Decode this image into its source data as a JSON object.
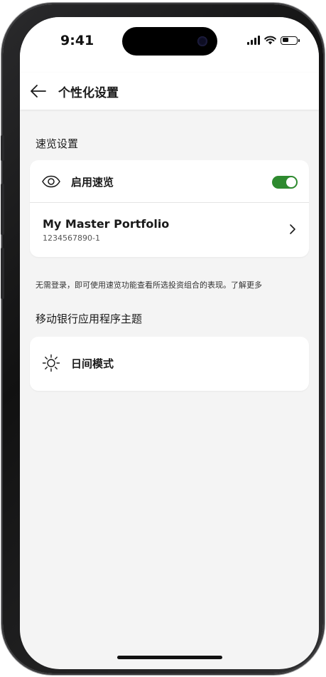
{
  "status_bar": {
    "time": "9:41",
    "battery_level": 0.45
  },
  "header": {
    "back_icon": "arrow-left-icon",
    "title": "个性化设置"
  },
  "quick_view": {
    "section_title": "速览设置",
    "enable": {
      "icon": "eye-icon",
      "label": "启用速览",
      "enabled": true,
      "toggle_color": "#2e8a2f"
    },
    "portfolio": {
      "name": "My Master Portfolio",
      "number": "1234567890-1",
      "chevron_icon": "chevron-right-icon"
    },
    "hint": "无需登录，即可使用速览功能查看所选投资组合的表现。了解更多"
  },
  "theme": {
    "section_title": "移动银行应用程序主题",
    "mode": {
      "icon": "sun-icon",
      "label": "日间模式"
    }
  }
}
